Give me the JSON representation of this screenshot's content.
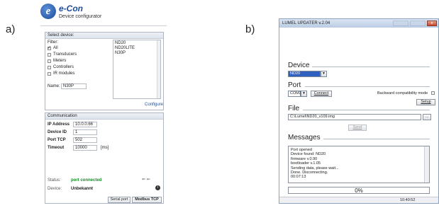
{
  "labels": {
    "a": "a)",
    "b": "b)"
  },
  "econ": {
    "logo_letter": "e",
    "title": "e-Con",
    "subtitle": "Device configurator",
    "select": {
      "title": "Select device:",
      "filter_label": "Filter:",
      "filters": [
        {
          "label": "All",
          "checked": true
        },
        {
          "label": "Transducers",
          "checked": false
        },
        {
          "label": "Meters",
          "checked": false
        },
        {
          "label": "Controllers",
          "checked": false
        },
        {
          "label": "IR modules",
          "checked": false
        }
      ],
      "devices": [
        "ND20",
        "ND20LITE",
        "N30P"
      ],
      "name_label": "Name:",
      "name_value": "N30P",
      "configure_link": "Configure"
    },
    "comm": {
      "title": "Communication",
      "ip_label": "IP Address",
      "ip_value": "10.0.0.66",
      "device_id_label": "Device ID",
      "device_id_value": "1",
      "port_label": "Port TCP",
      "port_value": "502",
      "timeout_label": "Timeout",
      "timeout_value": "10000",
      "timeout_unit": "[ms]",
      "status_label": "Status:",
      "status_value": "port connected",
      "device_label": "Device:",
      "device_value": "Unbekannt",
      "serial_btn": "Serial port",
      "modbus_btn": "Modbus TCP"
    }
  },
  "lumel": {
    "title": "LUMEL UPDATER v.2.04",
    "close_glyph": "x",
    "device_title": "Device",
    "device_value": "ND20",
    "port_title": "Port",
    "port_value": "COM3",
    "connect_btn": "Connect",
    "backward_label": "Backward compatibility mode",
    "setup_btn": "Setup",
    "file_title": "File",
    "file_path": "C:\\Lumel\\ND20_v109.img",
    "browse_btn": "...",
    "send_btn": "Send",
    "messages_title": "Messages",
    "messages": [
      "Port opened",
      "Device found: ND20",
      "firmware v.0.90",
      " bootloader v.1.05",
      "Sending data, please wait...",
      "Done. Disconnecting.",
      "00:07:13"
    ],
    "progress_text": "0%",
    "status_time": "10:40:52"
  },
  "colors": {
    "accent": "#1d4d99",
    "connected": "#1a8a2a",
    "selection": "#2f5fbf"
  }
}
